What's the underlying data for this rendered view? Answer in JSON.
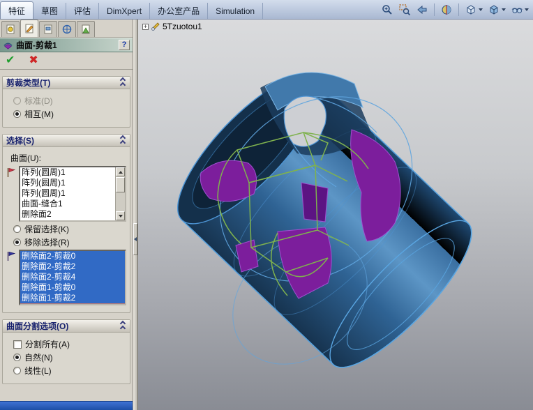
{
  "colors": {
    "selection_highlight": "#316ac5",
    "panel_bg": "#d6d2c9",
    "titlebar_gradient": [
      "#78988d",
      "#c9d6cd"
    ],
    "menubar_gradient": [
      "#d3ddec",
      "#a9b8d2"
    ],
    "viewport_bg_top": "#dadbdd",
    "viewport_bg_bottom": "#898c94",
    "model_surface_blue": "#2f6394",
    "model_edge_blue": "#55a0dc",
    "trim_face_purple": "#7c1e9c",
    "sketch_green": "#7fb24e",
    "ok_green": "#1f9e2e",
    "cancel_red": "#cf2626",
    "bottom_strip_blue": "#2b5cd0"
  },
  "menubar": {
    "tabs": [
      {
        "label": "特征",
        "active": true
      },
      {
        "label": "草图",
        "active": false
      },
      {
        "label": "评估",
        "active": false
      },
      {
        "label": "DimXpert",
        "active": false
      },
      {
        "label": "办公室产品",
        "active": false
      },
      {
        "label": "Simulation",
        "active": false
      }
    ],
    "view_toolbar_icons": [
      "zoom-to-fit",
      "zoom-to-area",
      "previous-view",
      "section-view",
      "view-orientation",
      "display-style",
      "hide-show-items"
    ]
  },
  "viewport": {
    "tree_root_label": "5Tzuotou1",
    "tree_expand_glyph": "+"
  },
  "property_manager": {
    "tab_icons": [
      "property-tab",
      "features-tab",
      "configuration-tab",
      "dimxpert-tab",
      "display-tab"
    ],
    "title": "曲面-剪裁1",
    "help_button": "?",
    "ok_glyph": "✔",
    "cancel_glyph": "✖",
    "trim_type": {
      "header": "剪裁类型(T)",
      "standard_label": "标准(D)",
      "mutual_label": "相互(M)",
      "selected": "相互(M)"
    },
    "selection": {
      "header": "选择(S)",
      "surfaces_label": "曲面(U):",
      "surfaces": [
        "阵列(圆周)1",
        "阵列(圆周)1",
        "阵列(圆周)1",
        "曲面-缝合1",
        "删除面2"
      ],
      "keep_label": "保留选择(K)",
      "remove_label": "移除选择(R)",
      "selected": "移除选择(R)",
      "pieces": [
        "删除面2-剪裁0",
        "删除面2-剪裁2",
        "删除面2-剪裁4",
        "删除面1-剪裁0",
        "删除面1-剪裁2"
      ],
      "pieces_all_selected": true
    },
    "split_options": {
      "header": "曲面分割选项(O)",
      "split_all_label": "分割所有(A)",
      "split_all_checked": false,
      "natural_label": "自然(N)",
      "linear_label": "线性(L)",
      "selected": "自然(N)"
    }
  }
}
